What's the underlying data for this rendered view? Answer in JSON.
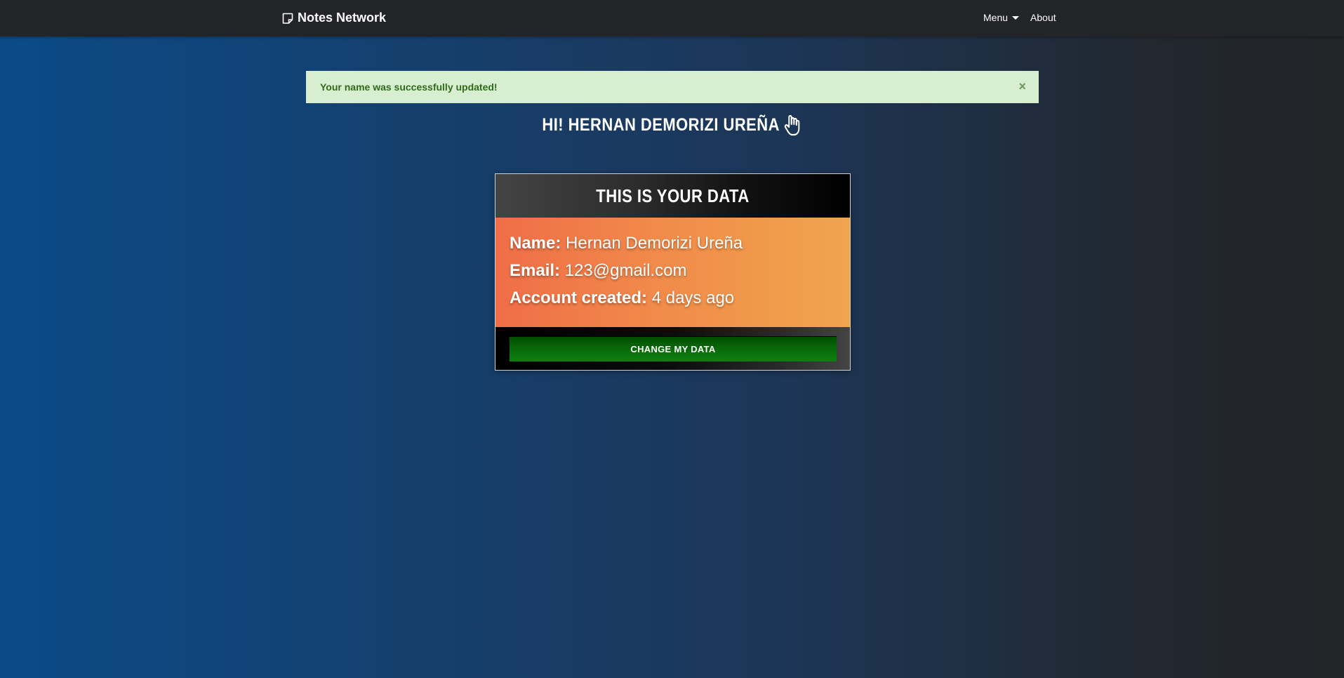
{
  "navbar": {
    "brand": "Notes Network",
    "brand_icon": "sticky-note-icon",
    "menu_label": "Menu",
    "about_label": "About"
  },
  "alert": {
    "message": "Your name was successfully updated!",
    "close_symbol": "×"
  },
  "greeting": {
    "text": "Hi! Hernan Demorizi Ureña",
    "icon": "waving-hand-icon"
  },
  "card": {
    "title": "This is your data",
    "fields": [
      {
        "label": "Name:",
        "value": "Hernan Demorizi Ureña"
      },
      {
        "label": "Email:",
        "value": "123@gmail.com"
      },
      {
        "label": "Account created:",
        "value": "4 days ago"
      }
    ],
    "button_label": "Change my data"
  },
  "colors": {
    "navbar_bg": "#222427",
    "alert_bg": "#d8eed0",
    "alert_text": "#2f6b1a",
    "card_body_start": "#f06d47",
    "card_body_end": "#f0a54d",
    "button_green": "#0a6d0a"
  }
}
